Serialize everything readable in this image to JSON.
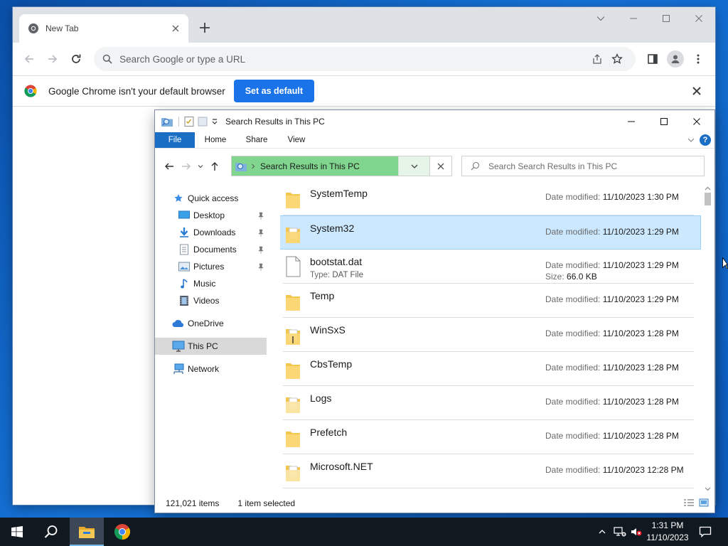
{
  "chrome": {
    "tab_title": "New Tab",
    "omnibox_placeholder": "Search Google or type a URL",
    "infobar_message": "Google Chrome isn't your default browser",
    "set_default_label": "Set as default",
    "accent": "#1a73e8"
  },
  "explorer": {
    "title": "Search Results in This PC",
    "ribbon_tabs": [
      "File",
      "Home",
      "Share",
      "View"
    ],
    "address_crumb": "Search Results in This PC",
    "search_placeholder": "Search Search Results in This PC",
    "nav": {
      "quick_access": "Quick access",
      "desktop": "Desktop",
      "downloads": "Downloads",
      "documents": "Documents",
      "pictures": "Pictures",
      "music": "Music",
      "videos": "Videos",
      "onedrive": "OneDrive",
      "this_pc": "This PC",
      "network": "Network"
    },
    "date_label": "Date modified:",
    "type_label": "Type:",
    "size_label": "Size:",
    "files": [
      {
        "name": "SystemTemp",
        "date": "11/10/2023 1:30 PM",
        "kind": "folder"
      },
      {
        "name": "System32",
        "date": "11/10/2023 1:29 PM",
        "kind": "folder-doc",
        "selected": true
      },
      {
        "name": "bootstat.dat",
        "date": "11/10/2023 1:29 PM",
        "kind": "file",
        "type": "DAT File",
        "size": "66.0 KB"
      },
      {
        "name": "Temp",
        "date": "11/10/2023 1:29 PM",
        "kind": "folder"
      },
      {
        "name": "WinSxS",
        "date": "11/10/2023 1:28 PM",
        "kind": "folder-doc"
      },
      {
        "name": "CbsTemp",
        "date": "11/10/2023 1:28 PM",
        "kind": "folder"
      },
      {
        "name": "Logs",
        "date": "11/10/2023 1:28 PM",
        "kind": "folder-doc"
      },
      {
        "name": "Prefetch",
        "date": "11/10/2023 1:28 PM",
        "kind": "folder"
      },
      {
        "name": "Microsoft.NET",
        "date": "11/10/2023 12:28 PM",
        "kind": "folder-doc"
      }
    ],
    "status_count": "121,021 items",
    "status_selected": "1 item selected",
    "selection_color": "#cce8ff"
  },
  "taskbar": {
    "time": "1:31 PM",
    "date": "11/10/2023"
  }
}
